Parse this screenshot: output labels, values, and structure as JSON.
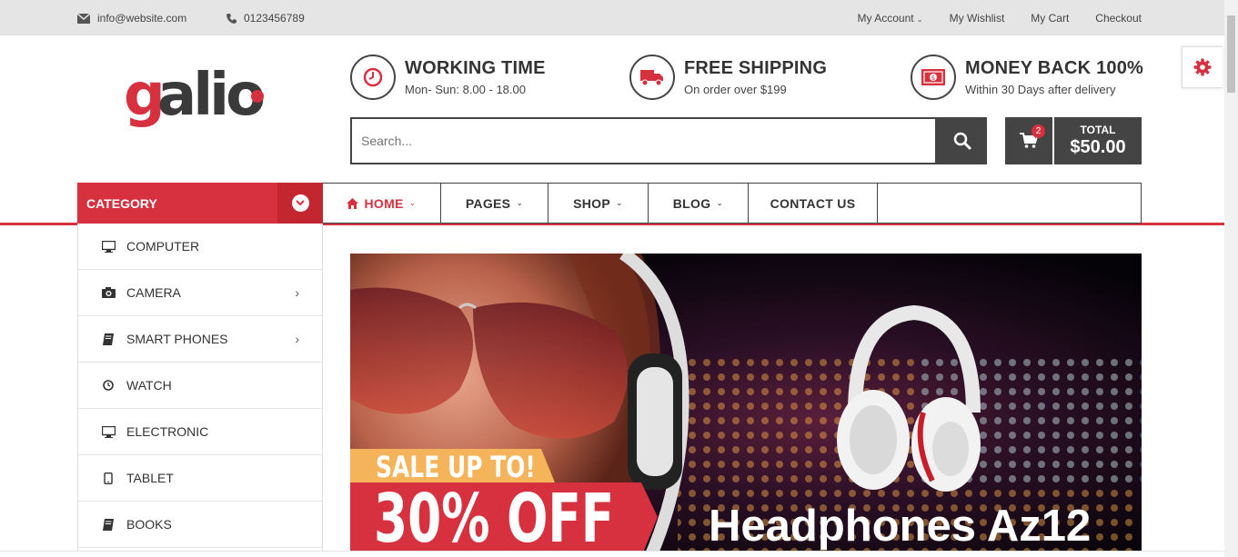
{
  "topbar": {
    "email": "info@website.com",
    "phone": "0123456789",
    "links": [
      "My Account",
      "My Wishlist",
      "My Cart",
      "Checkout"
    ]
  },
  "logo": {
    "text": "galio"
  },
  "features": [
    {
      "title": "WORKING TIME",
      "subtitle": "Mon- Sun: 8.00 - 18.00",
      "icon": "clock-icon"
    },
    {
      "title": "FREE SHIPPING",
      "subtitle": "On order over $199",
      "icon": "truck-icon"
    },
    {
      "title": "MONEY BACK 100%",
      "subtitle": "Within 30 Days after delivery",
      "icon": "money-icon"
    }
  ],
  "search": {
    "placeholder": "Search..."
  },
  "cart": {
    "count": "2",
    "total_label": "TOTAL",
    "total_amount": "$50.00"
  },
  "category": {
    "title": "CATEGORY",
    "items": [
      {
        "label": "COMPUTER",
        "icon": "desktop-icon",
        "has_sub": false
      },
      {
        "label": "CAMERA",
        "icon": "camera-icon",
        "has_sub": true
      },
      {
        "label": "SMART PHONES",
        "icon": "book-icon",
        "has_sub": true
      },
      {
        "label": "WATCH",
        "icon": "clock-icon",
        "has_sub": false
      },
      {
        "label": "ELECTRONIC",
        "icon": "desktop-icon",
        "has_sub": false
      },
      {
        "label": "TABLET",
        "icon": "tablet-icon",
        "has_sub": false
      },
      {
        "label": "BOOKS",
        "icon": "book-icon",
        "has_sub": false
      }
    ]
  },
  "nav": {
    "items": [
      {
        "label": "HOME",
        "active": true,
        "dropdown": true
      },
      {
        "label": "PAGES",
        "active": false,
        "dropdown": true
      },
      {
        "label": "SHOP",
        "active": false,
        "dropdown": true
      },
      {
        "label": "BLOG",
        "active": false,
        "dropdown": true
      },
      {
        "label": "CONTACT US",
        "active": false,
        "dropdown": false
      }
    ]
  },
  "banner": {
    "sale_text": "SALE UP TO!",
    "discount_text": "30% OFF",
    "product_title": "Headphones Az12"
  },
  "colors": {
    "accent": "#d7303f",
    "dark": "#444444",
    "sale_yellow": "#f5b35a"
  }
}
